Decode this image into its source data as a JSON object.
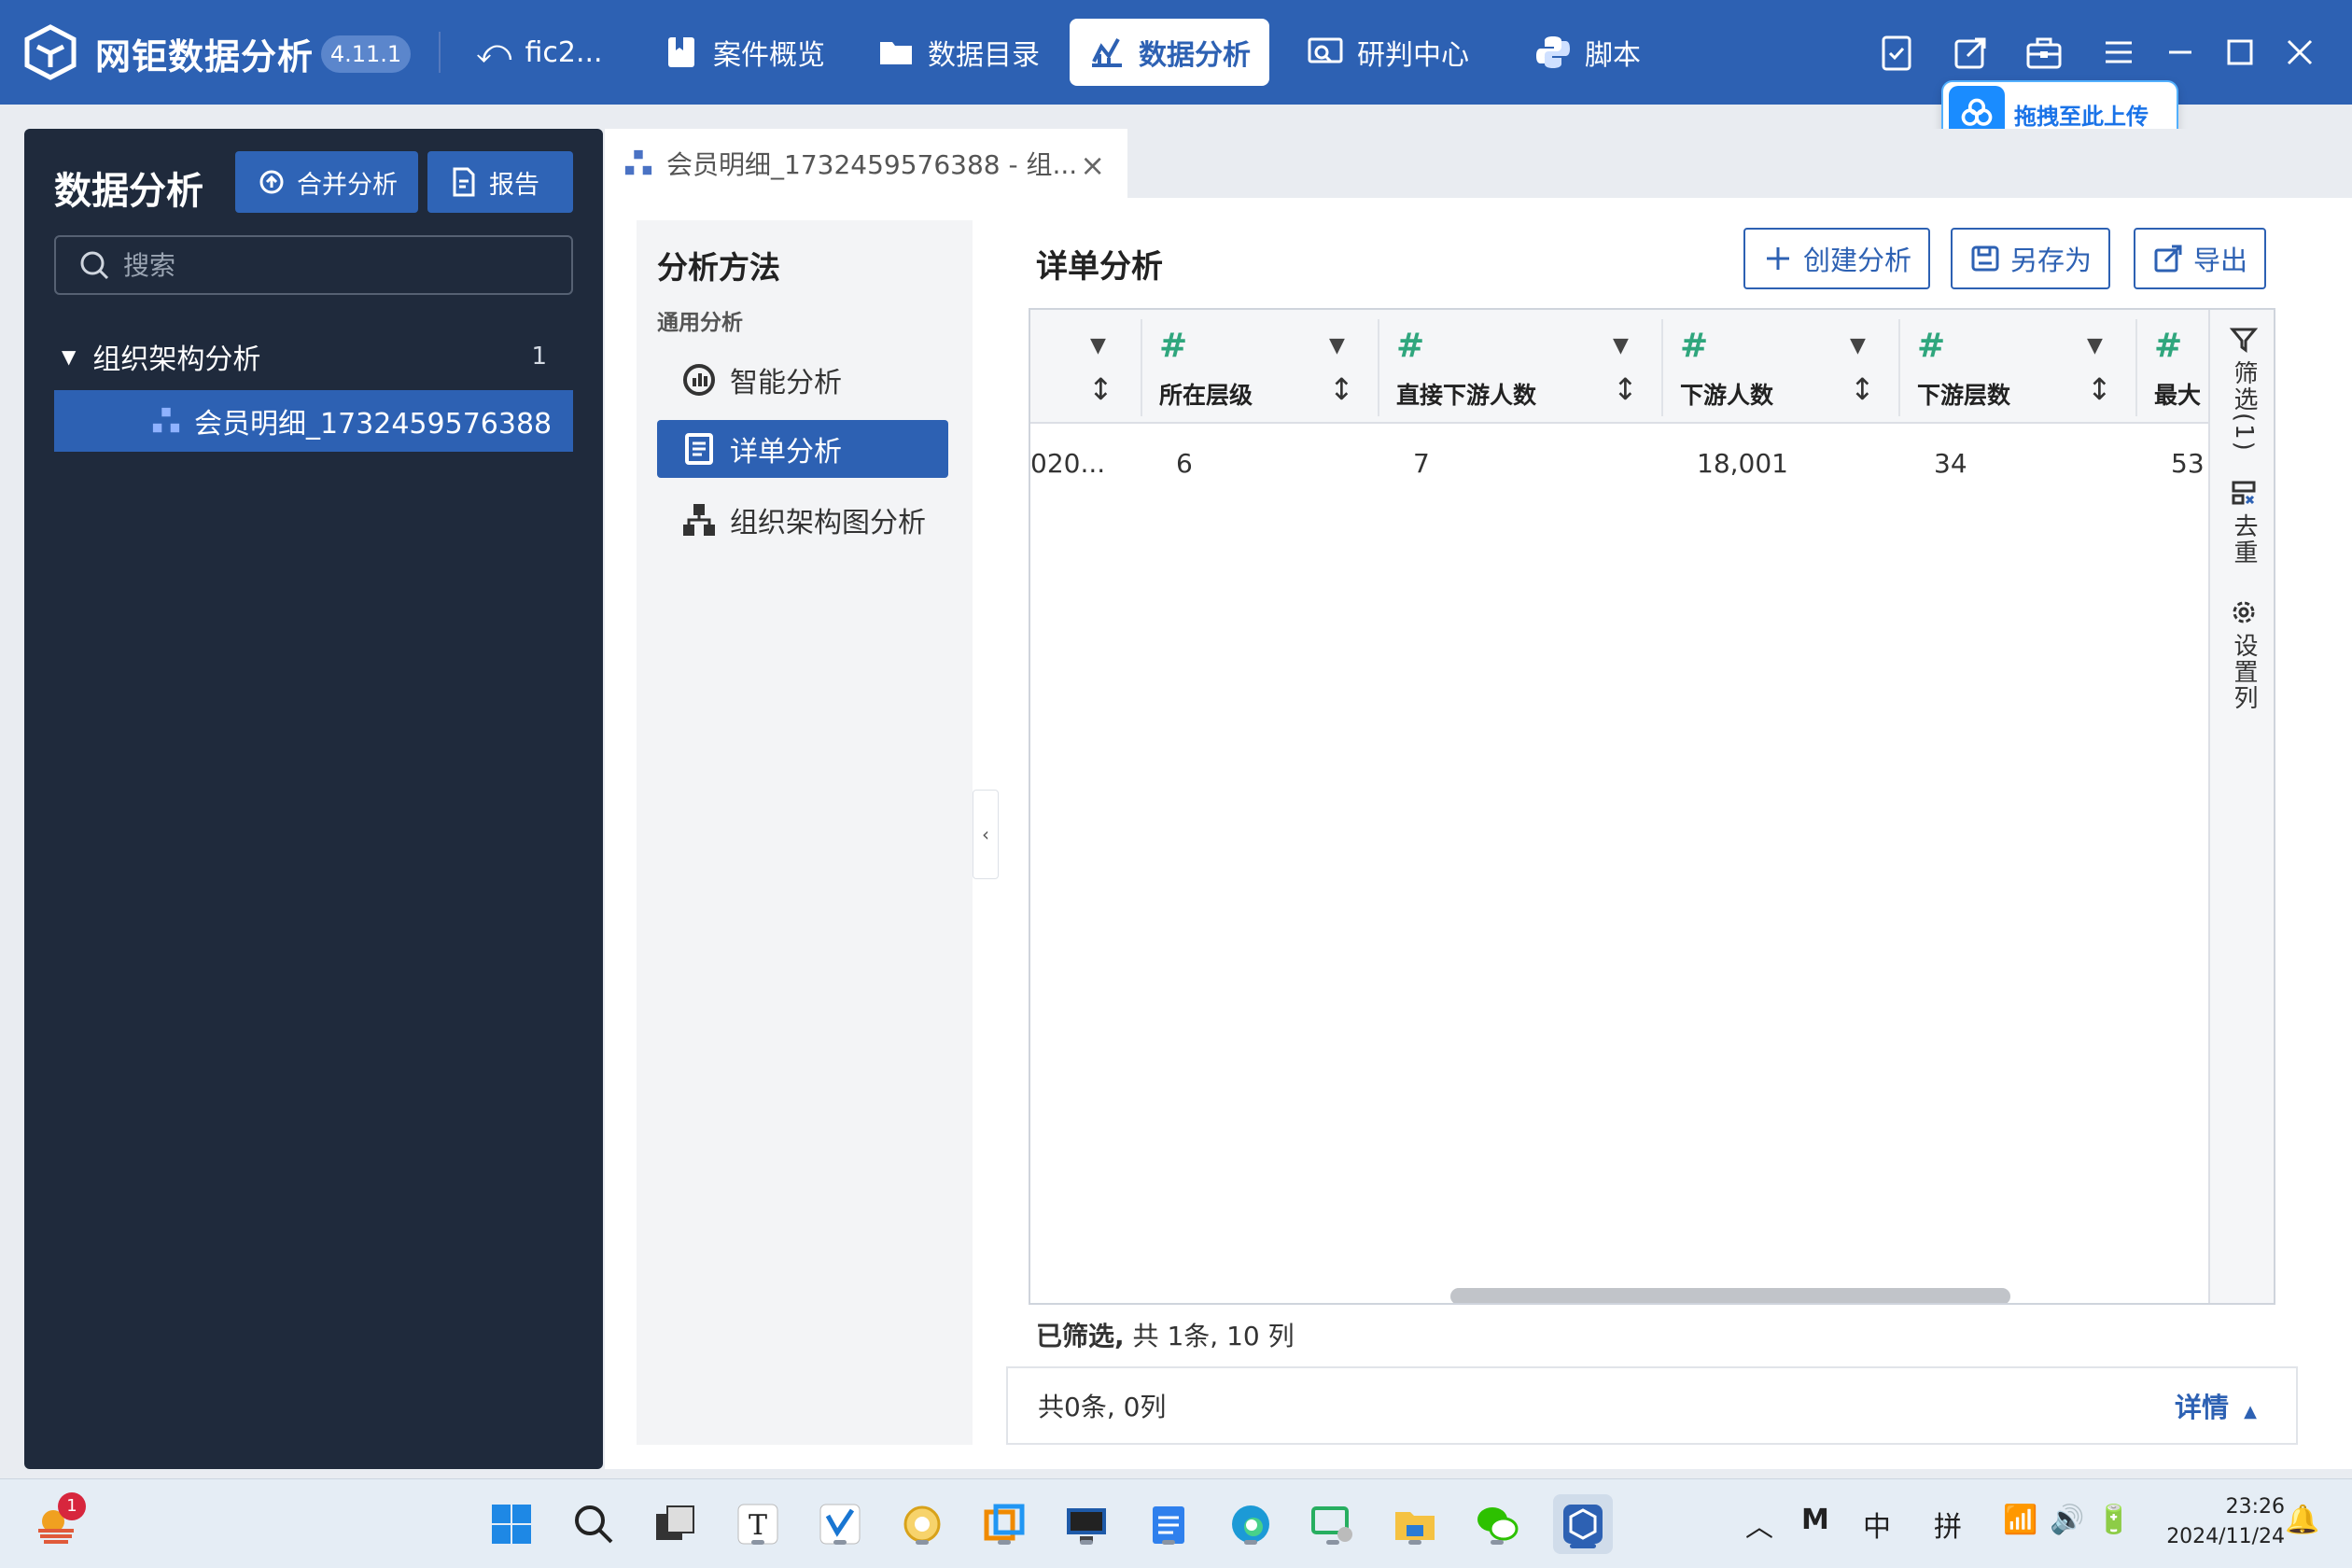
{
  "app": {
    "name": "网钜数据分析",
    "version": "4.11.1",
    "case_name": "fic2...",
    "nav": [
      "案件概览",
      "数据目录",
      "数据分析",
      "研判中心",
      "脚本"
    ],
    "active_nav": "数据分析",
    "upload_label": "拖拽至此上传",
    "accent": "#2d61b3"
  },
  "left": {
    "title": "数据分析",
    "merge_button": "合并分析",
    "report_button": "报告",
    "search_placeholder": "搜索",
    "tree": {
      "group_label": "组织架构分析",
      "group_count": "1",
      "item_label": "会员明细_1732459576388"
    }
  },
  "tab": {
    "label": "会员明细_1732459576388 - 组..."
  },
  "method": {
    "title": "分析方法",
    "group": "通用分析",
    "items": [
      "智能分析",
      "详单分析",
      "组织架构图分析"
    ]
  },
  "detail": {
    "title": "详单分析",
    "create_button": "创建分析",
    "saveas_button": "另存为",
    "export_button": "导出",
    "columns": [
      {
        "name": "",
        "value": "020..."
      },
      {
        "name": "所在层级",
        "value": "6"
      },
      {
        "name": "直接下游人数",
        "value": "7"
      },
      {
        "name": "下游人数",
        "value": "18,001"
      },
      {
        "name": "下游层数",
        "value": "34"
      },
      {
        "name": "最大",
        "value": "53"
      }
    ],
    "tools": {
      "filter": "筛选(1)",
      "dedup": "去重",
      "settings": "设置列"
    },
    "status_filtered": "已筛选,",
    "status_rest": "共 1条, 10 列",
    "footer_text": "共0条, 0列",
    "footer_detail": "详情"
  },
  "taskbar": {
    "badge": "1",
    "tray_lang": "中",
    "tray_ime": "拼",
    "time": "23:26",
    "date": "2024/11/24"
  }
}
